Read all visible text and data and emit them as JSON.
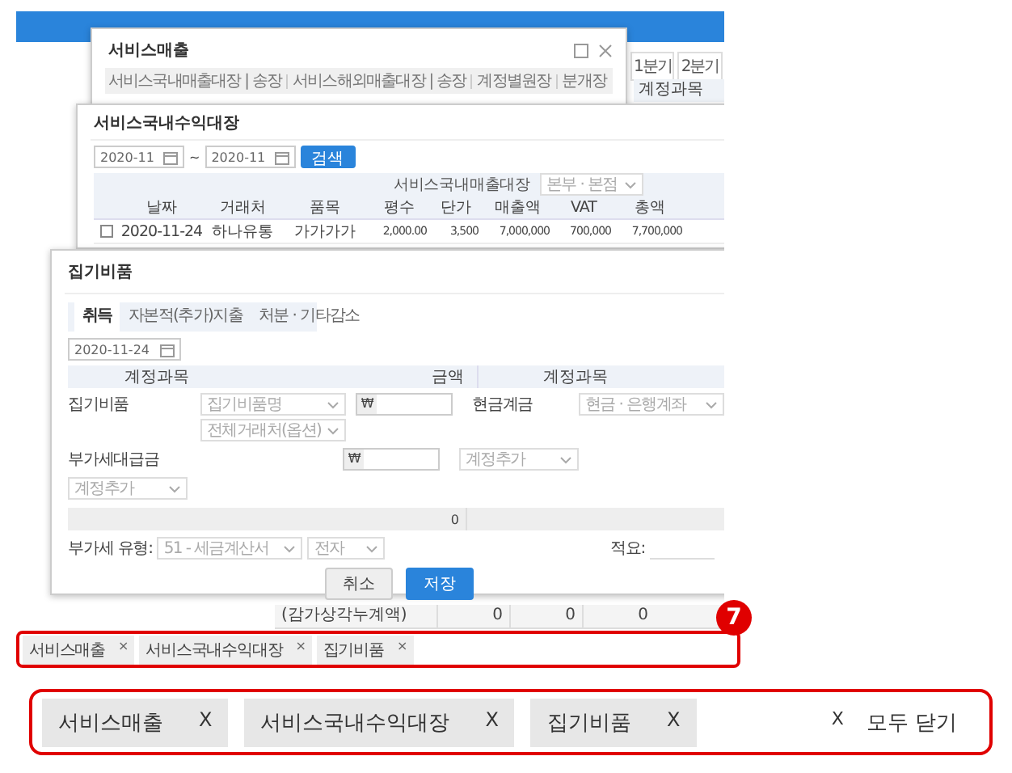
{
  "background_page": {
    "period_buttons": [
      {
        "label": "1분기"
      },
      {
        "label": "2분기"
      }
    ],
    "column_header": "계정과목",
    "rows": [
      {
        "account": "(감가상각누계액)",
        "values": [
          "0",
          "0",
          "0"
        ]
      }
    ]
  },
  "service_sales_window": {
    "title": "서비스매출",
    "tabs": [
      "서비스국내매출대장 | 송장",
      "서비스해외매출대장 | 송장",
      "계정별원장",
      "분개장"
    ]
  },
  "domestic_revenue_window": {
    "title": "서비스국내수익대장",
    "date_from": "2020-11",
    "range_separator": "~",
    "date_to": "2020-11",
    "search_button": "검색",
    "ledger_label": "서비스국내매출대장",
    "branch_dropdown": "본부 · 본점",
    "columns": [
      "날짜",
      "거래처",
      "품목",
      "평수",
      "단가",
      "매출액",
      "VAT",
      "총액"
    ],
    "rows": [
      {
        "checked": false,
        "cells": [
          "2020-11-24",
          "하나유통",
          "가가가가",
          "2,000.00",
          "3,500",
          "7,000,000",
          "700,000",
          "7,700,000"
        ]
      }
    ]
  },
  "fixed_asset_window": {
    "title": "집기비품",
    "tabs": [
      {
        "label": "취득",
        "selected": true
      },
      {
        "label": "자본적(추가)지출",
        "selected": false
      },
      {
        "label": "처분 · 기타감소",
        "selected": false
      }
    ],
    "date": "2020-11-24",
    "columns": [
      "계정과목",
      "금액",
      "계정과목"
    ],
    "debit_account": "집기비품",
    "item_dropdown": "집기비품명",
    "vendor_dropdown": "전체거래처(옵션)",
    "currency": "₩",
    "credit_account": "현금계금",
    "bank_dropdown": "현금 · 은행계좌",
    "vat_account": "부가세대급금",
    "vat_currency": "₩",
    "vat_add_dropdown": "계정추가",
    "add_dropdown": "계정추가",
    "total": "0",
    "vat_type_label": "부가세 유형:",
    "vat_type": "51 - 세금계산서",
    "invoice_type": "전자",
    "memo_label": "적요:",
    "buttons": [
      {
        "label": "취소",
        "kind": "secondary"
      },
      {
        "label": "저장",
        "kind": "primary"
      }
    ]
  },
  "open_tabs": [
    {
      "label": "서비스매출",
      "close": "×"
    },
    {
      "label": "서비스국내수익대장",
      "close": "×"
    },
    {
      "label": "집기비품",
      "close": "×"
    }
  ],
  "callout": "7",
  "open_tabs_zoom": {
    "tabs": [
      {
        "label": "서비스매출",
        "close": "X"
      },
      {
        "label": "서비스국내수익대장",
        "close": "X"
      },
      {
        "label": "집기비품",
        "close": "X"
      }
    ],
    "close_all_mark": "X",
    "close_all": "모두 닫기"
  }
}
